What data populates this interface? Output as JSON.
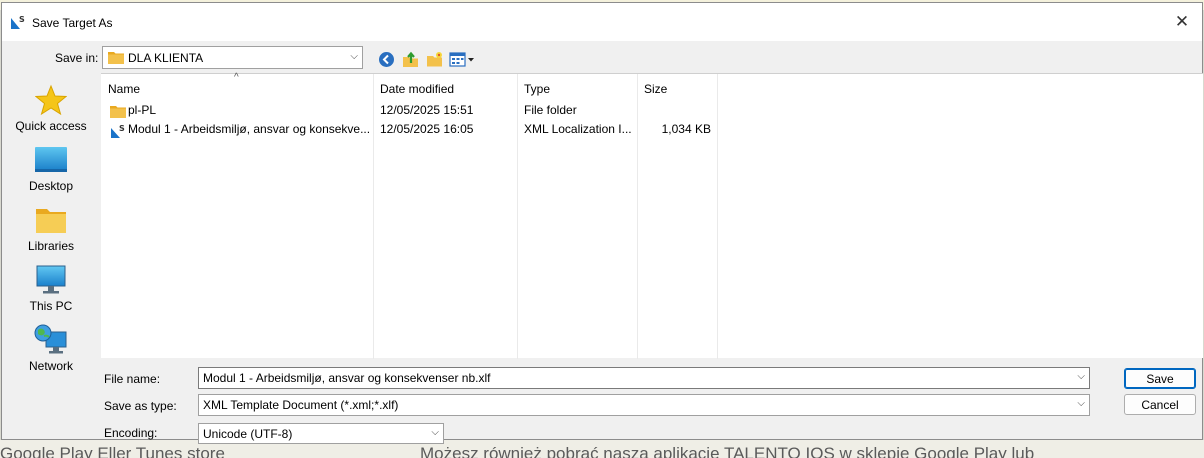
{
  "background": {
    "bottom_texts": [
      "Google Play Eller Tunes store",
      "Możesz również pobrać naszą aplikację TALENTO IOS w sklepie Google Play lub"
    ]
  },
  "dialog": {
    "title": "Save Target As",
    "close_symbol": "✕",
    "save_in": {
      "label": "Save in:",
      "value": "DLA KLIENTA"
    },
    "toolbar": {
      "icons": [
        "back-icon",
        "up-folder-icon",
        "new-folder-icon",
        "view-menu-icon"
      ]
    },
    "places": [
      {
        "label": "Quick access",
        "icon": "star-icon"
      },
      {
        "label": "Desktop",
        "icon": "desktop-icon"
      },
      {
        "label": "Libraries",
        "icon": "libraries-icon"
      },
      {
        "label": "This PC",
        "icon": "this-pc-icon"
      },
      {
        "label": "Network",
        "icon": "network-icon"
      }
    ],
    "list": {
      "columns": [
        "Name",
        "Date modified",
        "Type",
        "Size"
      ],
      "sort_indicator": "^",
      "rows": [
        {
          "name": "pl-PL",
          "date": "12/05/2025 15:51",
          "type": "File folder",
          "size": "",
          "icon": "folder-icon"
        },
        {
          "name": "Modul 1 - Arbeidsmiljø, ansvar og konsekve...",
          "date": "12/05/2025 16:05",
          "type": "XML Localization I...",
          "size": "1,034 KB",
          "icon": "xml-file-icon"
        }
      ]
    },
    "file_name": {
      "label": "File name:",
      "value": "Modul 1 - Arbeidsmiljø, ansvar og konsekvenser nb.xlf"
    },
    "save_as_type": {
      "label": "Save as type:",
      "value": "XML Template Document (*.xml;*.xlf)"
    },
    "encoding": {
      "label": "Encoding:",
      "value": "Unicode (UTF-8)"
    },
    "buttons": {
      "save": "Save",
      "cancel": "Cancel"
    },
    "colors": {
      "accent": "#0067c0",
      "folder": "#f3c14b"
    }
  }
}
